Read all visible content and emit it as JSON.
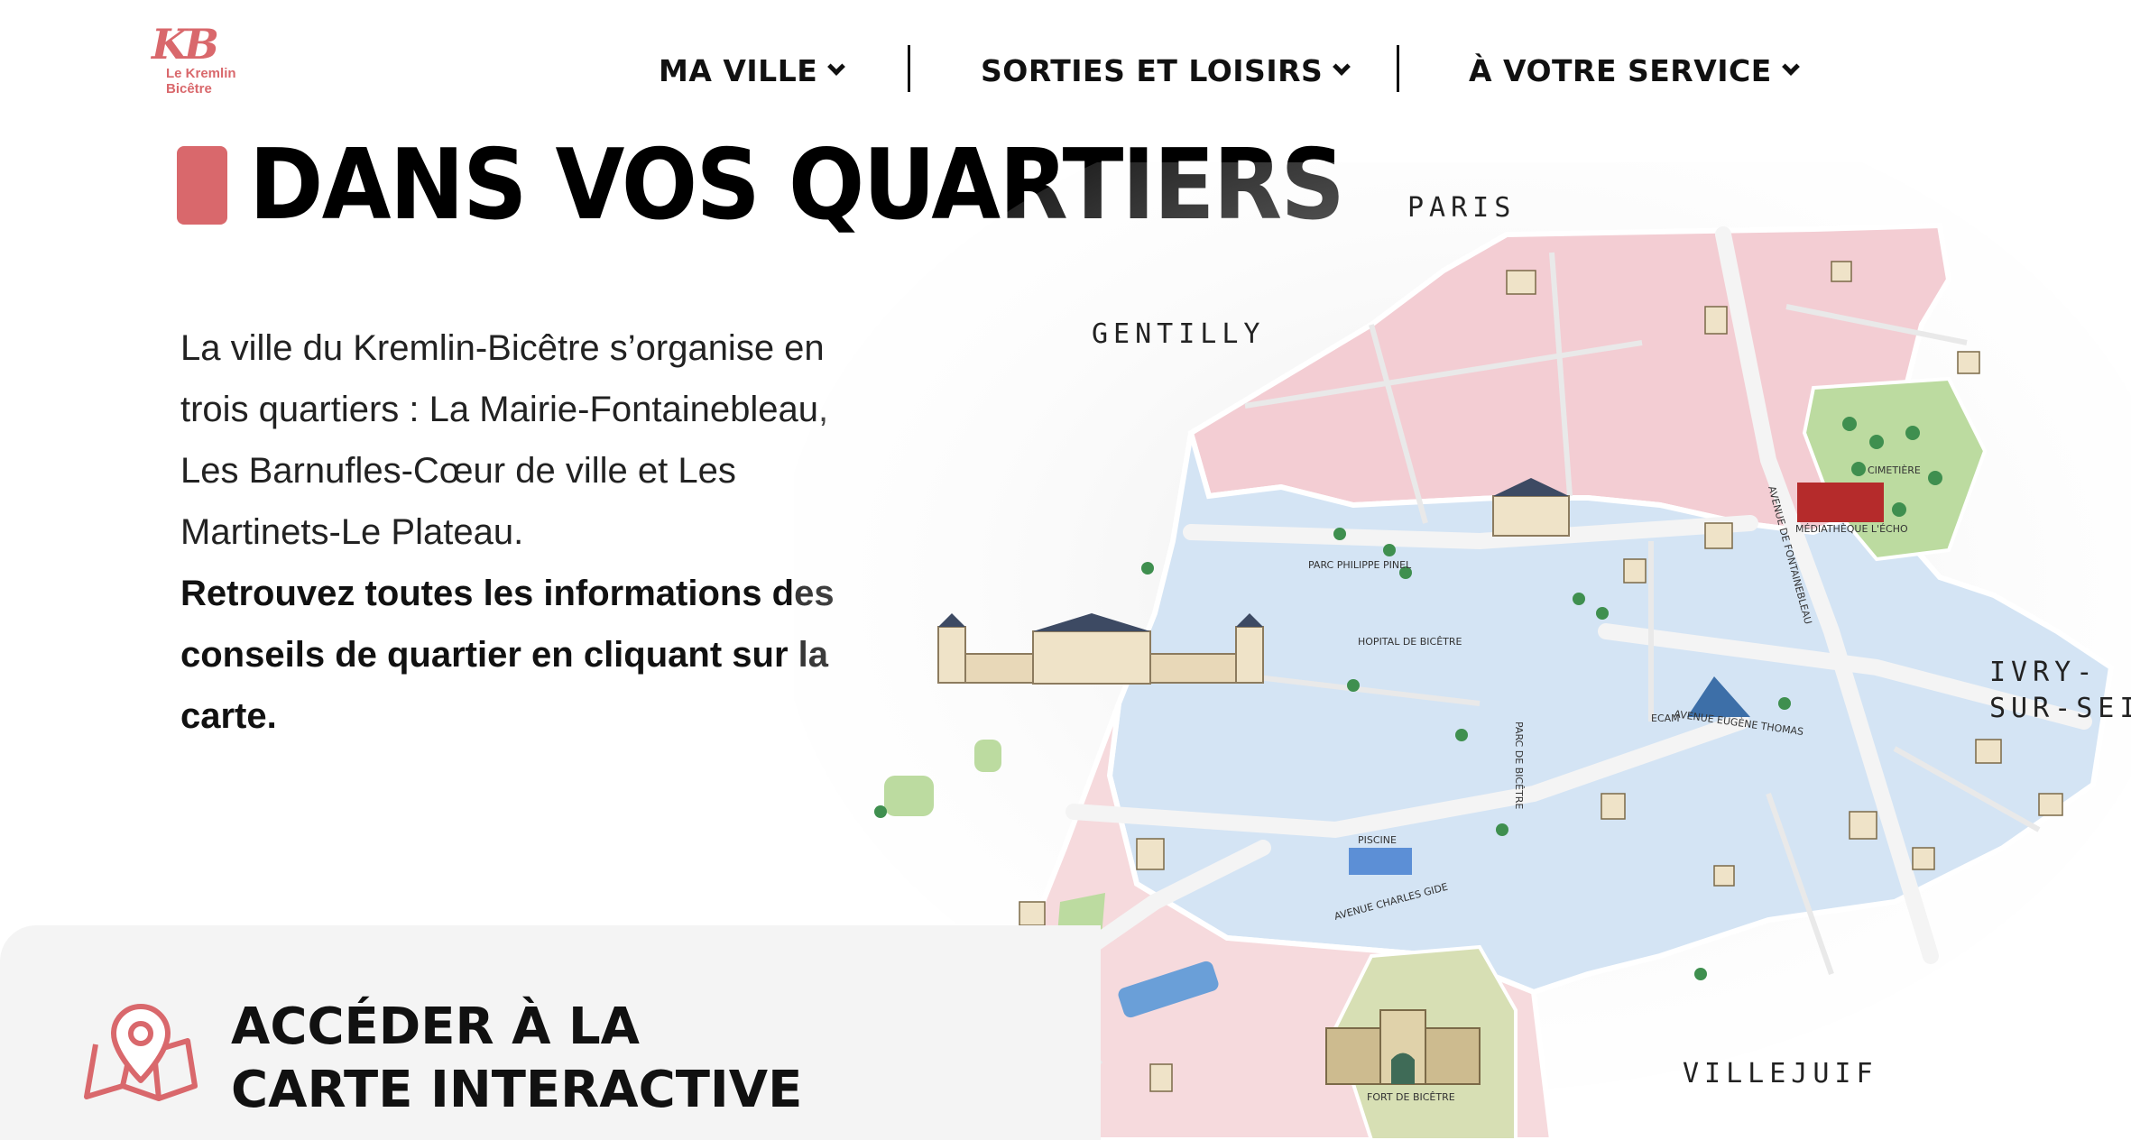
{
  "logo": {
    "mark": "KB",
    "line1": "Le Kremlin",
    "line2": "Bicêtre"
  },
  "nav": {
    "items": [
      {
        "label": "MA VILLE"
      },
      {
        "label": "SORTIES ET LOISIRS"
      },
      {
        "label": "À VOTRE SERVICE"
      }
    ]
  },
  "page": {
    "title": "DANS VOS QUARTIERS",
    "intro_lines": [
      "La ville du Kremlin-Bicêtre s’organise en",
      "trois quartiers : La Mairie-Fontainebleau,",
      "Les Barnufles-Cœur de ville et Les",
      "Martinets-Le Plateau."
    ],
    "intro_strong_lines": [
      "Retrouvez toutes les informations des",
      "conseils de quartier en cliquant sur la",
      "carte."
    ]
  },
  "map": {
    "labels": {
      "paris": "PARIS",
      "gentilly": "GENTILLY",
      "ivry_line1": "IVRY-",
      "ivry_line2": "SUR-SEINE",
      "villejuif": "VILLEJUIF",
      "hopital": "HOPITAL DE BICÊTRE",
      "avenue_fontainebleau": "AVENUE DE FONTAINEBLEAU",
      "avenue_eugene_thomas": "AVENUE EUGÈNE THOMAS",
      "avenue_charles_gide": "AVENUE CHARLES GIDE",
      "mediatheque": "MÉDIATHÈQUE L'ÉCHO",
      "cimetiere": "CIMETIÈRE",
      "parc_philippe_pinel": "PARC PHILIPPE PINEL",
      "parc_bicetre": "PARC DE BICÊTRE",
      "fort": "FORT DE BICÊTRE",
      "ecam": "ECAM",
      "piscine": "PISCINE"
    },
    "colors": {
      "pink": "#f3cdd3",
      "blue": "#d4e4f4",
      "green": "#bcdba0",
      "olive": "#d7dfb4",
      "road": "#f4f4f4",
      "accent": "#d9686c"
    }
  },
  "cta": {
    "line1": "ACCÉDER À LA",
    "line2": "CARTE INTERACTIVE",
    "icon": "map-pin-icon"
  }
}
